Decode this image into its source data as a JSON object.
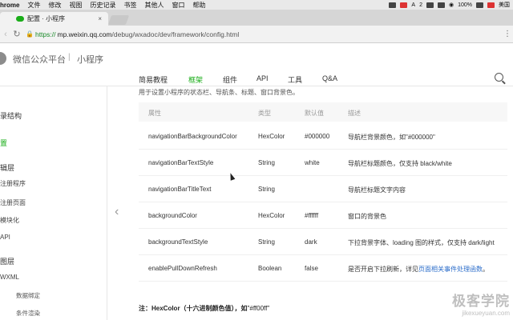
{
  "menubar": {
    "app": "hrome",
    "items": [
      "文件",
      "修改",
      "视图",
      "历史记录",
      "书签",
      "其他人",
      "窗口",
      "帮助"
    ],
    "status": {
      "battery": "100%",
      "input": "美国",
      "a_label": "A",
      "a_count": "2"
    }
  },
  "browser": {
    "tab_title": "配置 · 小程序",
    "close": "×",
    "url_lock": "🔒",
    "url_scheme": "https://",
    "url_host": "mp.weixin.qq.com",
    "url_path": "/debug/wxadoc/dev/framework/config.html"
  },
  "site": {
    "brand": "微信公众平台",
    "separator": "|",
    "sub": "小程序"
  },
  "nav": {
    "items": [
      "简易教程",
      "框架",
      "组件",
      "API",
      "工具",
      "Q&A"
    ],
    "active_index": 1
  },
  "sidebar": {
    "items": [
      {
        "label": "录结构",
        "level": 0
      },
      {
        "label": "置",
        "level": 0,
        "active": true
      },
      {
        "label": "辑层",
        "level": 0
      },
      {
        "label": "注册程序",
        "level": 1
      },
      {
        "label": "注册页面",
        "level": 1
      },
      {
        "label": "模块化",
        "level": 1
      },
      {
        "label": "API",
        "level": 1
      },
      {
        "label": "图层",
        "level": 0
      },
      {
        "label": "WXML",
        "level": 1
      },
      {
        "label": "数据绑定",
        "level": 2
      },
      {
        "label": "条件渲染",
        "level": 2
      }
    ]
  },
  "main": {
    "intro": "用于设置小程序的状态栏、导航条、标题、窗口背景色。",
    "columns": [
      "属性",
      "类型",
      "默认值",
      "描述"
    ],
    "rows": [
      {
        "prop": "navigationBarBackgroundColor",
        "type": "HexColor",
        "default": "#000000",
        "desc": "导航栏背景颜色，如\"#000000\""
      },
      {
        "prop": "navigationBarTextStyle",
        "type": "String",
        "default": "white",
        "desc": "导航栏标题颜色，仅支持 black/white"
      },
      {
        "prop": "navigationBarTitleText",
        "type": "String",
        "default": "",
        "desc": "导航栏标题文字内容"
      },
      {
        "prop": "backgroundColor",
        "type": "HexColor",
        "default": "#ffffff",
        "desc": "窗口的背景色"
      },
      {
        "prop": "backgroundTextStyle",
        "type": "String",
        "default": "dark",
        "desc": "下拉背景字体、loading 图的样式，仅支持 dark/light"
      },
      {
        "prop": "enablePullDownRefresh",
        "type": "Boolean",
        "default": "false",
        "desc": "是否开启下拉刷新，详见",
        "desc_link": "页面相关事件处理函数",
        "desc_end": "。"
      }
    ],
    "note_label": "注：HexColor（十六进制颜色值），如",
    "note_value": "\"#ff00ff\""
  },
  "watermark": {
    "line1": "极客学院",
    "line2": "jikexueyuan.com"
  }
}
